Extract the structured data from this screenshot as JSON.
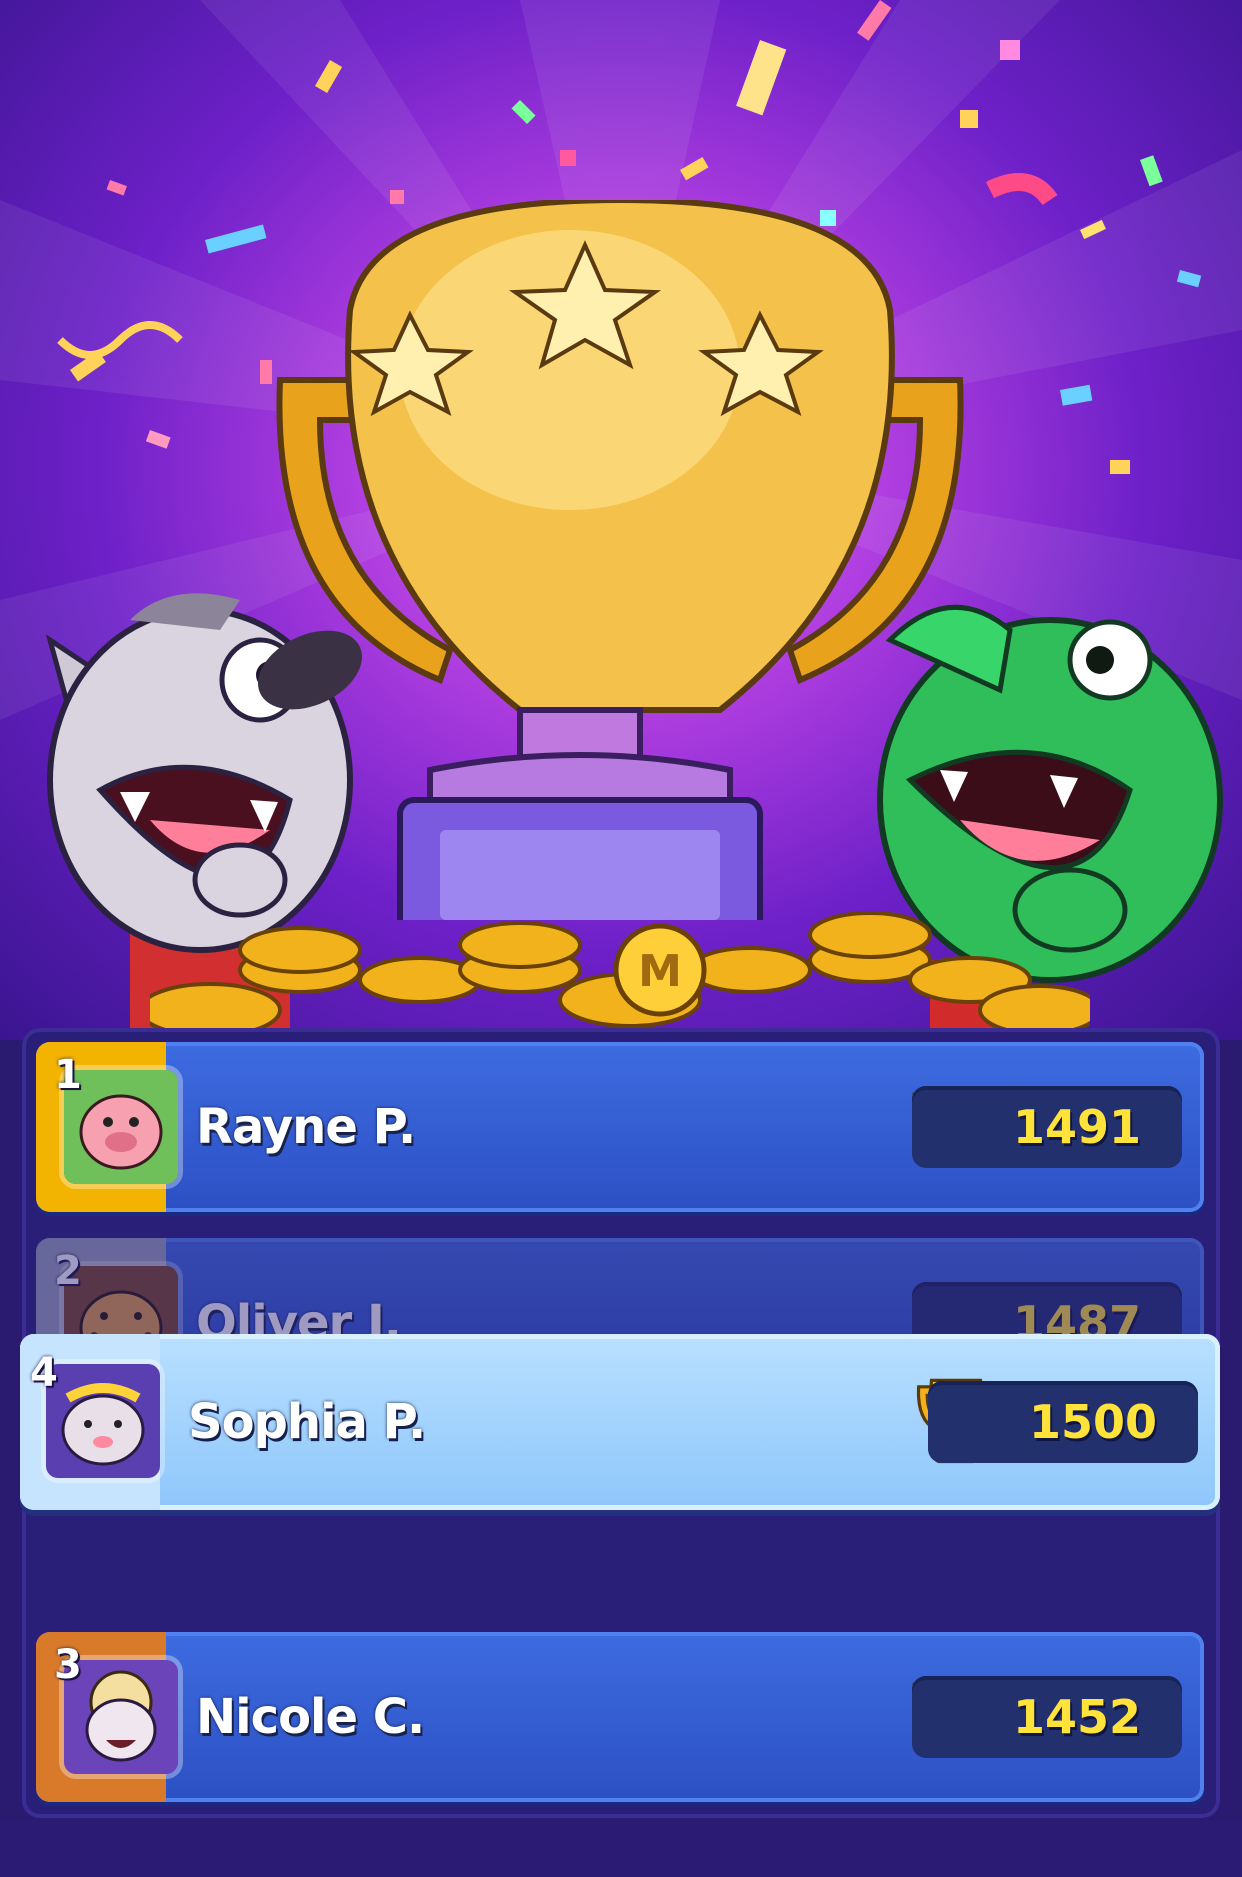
{
  "leaderboard": {
    "rows": [
      {
        "rank": "1",
        "name": "Rayne P.",
        "score": "1491",
        "rank_color": "#f2b400",
        "avatar": "pig-avatar"
      },
      {
        "rank": "2",
        "name": "Oliver J.",
        "score": "1487",
        "rank_color": "#9aa3b8",
        "avatar": "cheetah-avatar"
      },
      {
        "rank": "4",
        "name": "Sophia P.",
        "score": "1500",
        "rank_color": "#7a54d8",
        "avatar": "hamster-avatar",
        "highlighted": true
      },
      {
        "rank": "3",
        "name": "Nicole C.",
        "score": "1452",
        "rank_color": "#d97a2a",
        "avatar": "sheep-avatar"
      }
    ]
  },
  "icons": {
    "trophy": "trophy-icon",
    "hero_trophy": "big-trophy-illustration",
    "wolf": "wolf-character",
    "croc": "crocodile-character",
    "coins": "gold-coin-pile"
  },
  "colors": {
    "score_text": "#ffe23a",
    "row_blue": "#2c50c4",
    "highlight_row": "#9ccdfc"
  }
}
